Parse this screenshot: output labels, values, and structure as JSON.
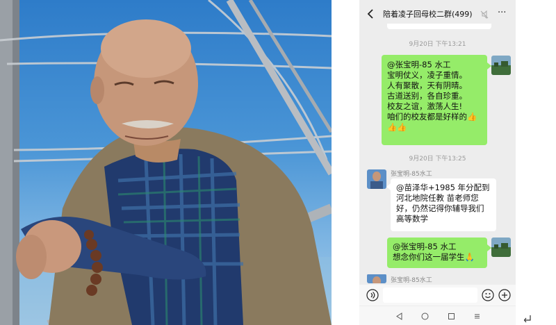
{
  "chat": {
    "title": "陪着凌子回母校二群(499)",
    "input_placeholder": ""
  },
  "timestamps": [
    "9月20日 下午13:21",
    "9月20日 下午13:25"
  ],
  "messages": [
    {
      "side": "right",
      "lines": [
        "@张宝明-85 水工",
        "宝明仗义，凌子重情。",
        "人有聚散，天有阴晴。",
        "古道送别，各自珍重。",
        "校友之谊，激荡人生!",
        "咱们的校友都是好样的👍",
        "👍👍"
      ]
    },
    {
      "side": "left",
      "sender": "张宝明-85水工",
      "lines": [
        "@苗泽华+1985 年分配到",
        "河北地院任教  苗老师您",
        "好，仍然记得你辅导我们",
        "高等数学"
      ]
    },
    {
      "side": "right",
      "lines": [
        "@张宝明-85 水工",
        "想念你们这一届学生🙏"
      ]
    },
    {
      "side": "left",
      "sender": "张宝明-85水工"
    }
  ],
  "icons": [
    "back-icon",
    "mute-icon",
    "more-icon",
    "voice-icon",
    "emoji-icon",
    "plus-icon",
    "nav-back-icon",
    "nav-home-icon",
    "nav-recents-icon",
    "nav-menu-icon",
    "corner-return-icon"
  ],
  "colors": {
    "green_bubble": "#95ec69",
    "chat_background": "#ededed",
    "sky": "#2e7cc9"
  }
}
